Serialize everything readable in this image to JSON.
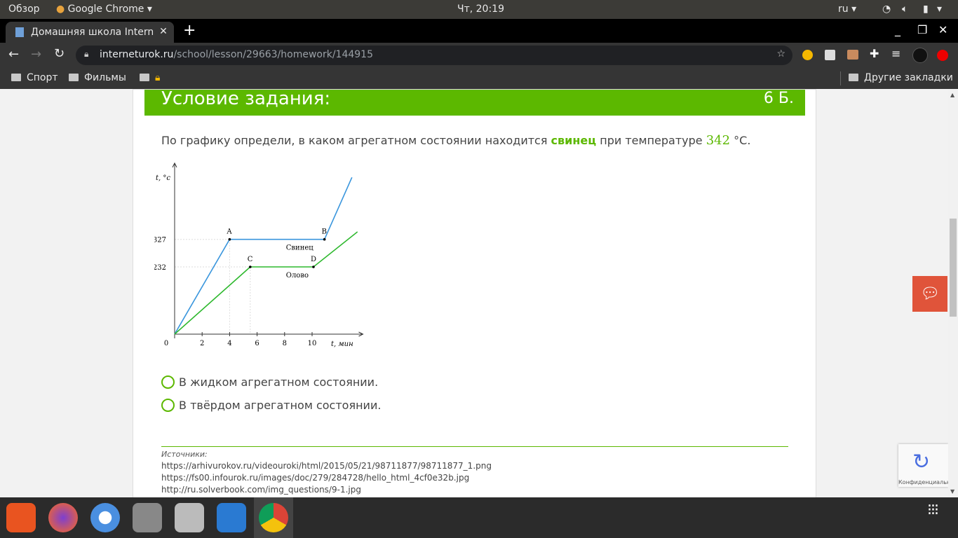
{
  "system": {
    "overview": "Обзор",
    "app": "Google Chrome",
    "clock": "Чт, 20:19",
    "lang": "ru"
  },
  "browser": {
    "tab_title": "Домашняя школа InternetUrok",
    "url_host": "interneturok.ru",
    "url_path": "/school/lesson/29663/homework/144915",
    "bookmarks": [
      "Спорт",
      "Фильмы",
      ""
    ],
    "other_bookmarks": "Другие закладки"
  },
  "task": {
    "title": "Условие задания:",
    "points": "6 Б.",
    "question_pre": "По графику определи, в каком агрегатном состоянии находится ",
    "substance": "свинец",
    "question_mid": " при температуре ",
    "temperature": "342",
    "question_post": " °C.",
    "options": [
      "В жидком агрегатном состоянии.",
      "В твёрдом агрегатном состоянии."
    ],
    "sources_label": "Источники:",
    "sources": [
      "https://arhivurokov.ru/videouroki/html/2015/05/21/98711877/98711877_1.png",
      "https://fs00.infourok.ru/images/doc/279/284728/hello_html_4cf0e32b.jpg",
      "http://ru.solverbook.com/img_questions/9-1.jpg"
    ]
  },
  "recaptcha": {
    "text": "Конфиденциальность - Условия"
  },
  "chart_data": {
    "type": "line",
    "xlabel": "t, мин",
    "ylabel": "t, °c",
    "xticks": [
      "0",
      "2",
      "4",
      "6",
      "8",
      "10"
    ],
    "yticks": [
      "232",
      "327"
    ],
    "xlim": [
      0,
      13.7
    ],
    "ylim": [
      0,
      590
    ],
    "series": [
      {
        "name": "Свинец",
        "color": "#3a96dd",
        "points": [
          [
            0,
            0
          ],
          [
            4,
            327
          ],
          [
            10.9,
            327
          ],
          [
            12.9,
            541
          ]
        ],
        "labels": [
          {
            "text": "A",
            "at": [
              4,
              327
            ]
          },
          {
            "text": "B",
            "at": [
              10.9,
              327
            ]
          }
        ]
      },
      {
        "name": "Олово",
        "color": "#2db82d",
        "points": [
          [
            0,
            0
          ],
          [
            5.5,
            232
          ],
          [
            10.1,
            232
          ],
          [
            13.3,
            353
          ]
        ],
        "labels": [
          {
            "text": "C",
            "at": [
              5.5,
              232
            ]
          },
          {
            "text": "D",
            "at": [
              10.1,
              232
            ]
          }
        ]
      }
    ]
  }
}
